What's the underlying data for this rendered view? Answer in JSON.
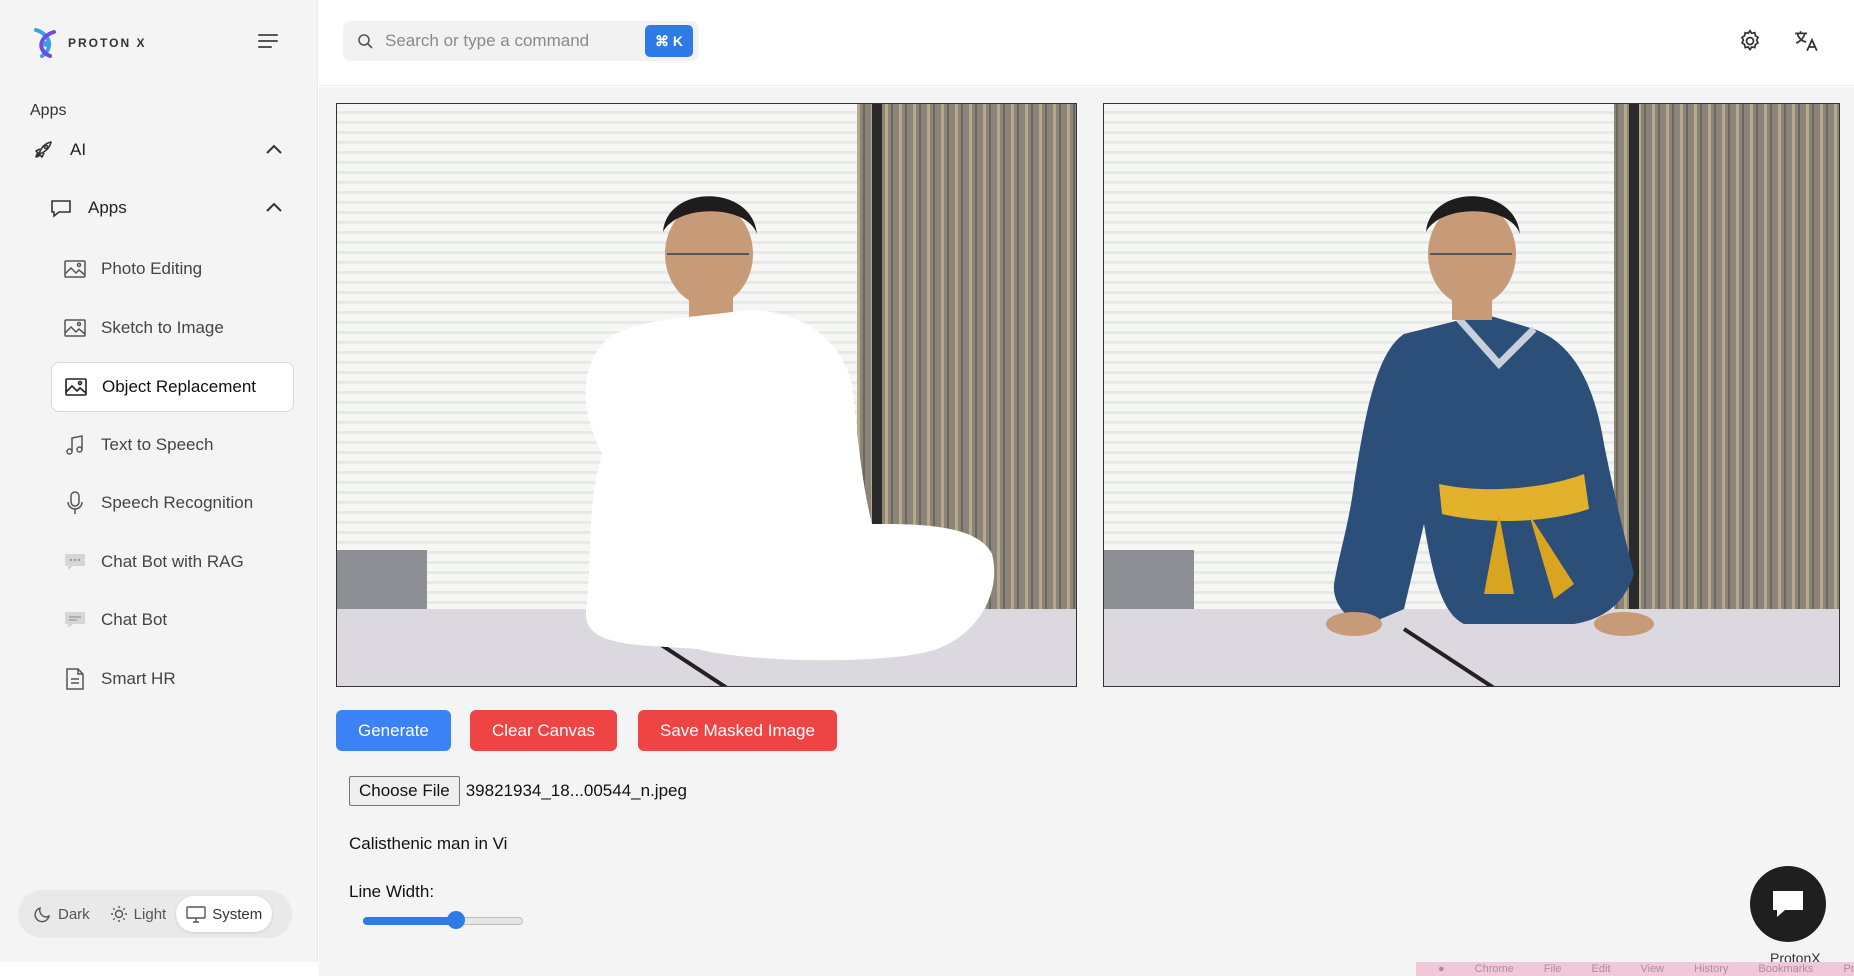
{
  "brand": {
    "name": "PROTON X",
    "footer": "ProtonX"
  },
  "sidebar": {
    "section_label": "Apps",
    "group": {
      "label": "AI"
    },
    "subgroup": {
      "label": "Apps"
    },
    "items": [
      {
        "label": "Photo Editing",
        "icon": "image-icon"
      },
      {
        "label": "Sketch to Image",
        "icon": "image-icon"
      },
      {
        "label": "Object Replacement",
        "icon": "image-icon",
        "active": true
      },
      {
        "label": "Text to Speech",
        "icon": "music-note-icon"
      },
      {
        "label": "Speech Recognition",
        "icon": "microphone-icon"
      },
      {
        "label": "Chat Bot with RAG",
        "icon": "chat-bubble-icon"
      },
      {
        "label": "Chat Bot",
        "icon": "chat-bubble-icon"
      },
      {
        "label": "Smart HR",
        "icon": "document-icon"
      }
    ],
    "theme": {
      "dark": "Dark",
      "light": "Light",
      "system": "System",
      "selected": "System"
    }
  },
  "topbar": {
    "search_placeholder": "Search or type a command",
    "shortcut": "⌘ K"
  },
  "main": {
    "buttons": {
      "generate": "Generate",
      "clear": "Clear Canvas",
      "save": "Save Masked Image"
    },
    "file": {
      "button": "Choose File",
      "name": "39821934_18...00544_n.jpeg"
    },
    "prompt_value": "Calisthenic man in Vi",
    "line_width_label": "Line Width:",
    "line_width_fraction": 0.58
  },
  "os_menu": [
    "Chrome",
    "File",
    "Edit",
    "View",
    "History",
    "Bookmarks",
    "Prof"
  ],
  "colors": {
    "accent": "#3b82f6",
    "danger": "#ef4444",
    "robe": "#2b4f78",
    "sash": "#e2b22c"
  }
}
